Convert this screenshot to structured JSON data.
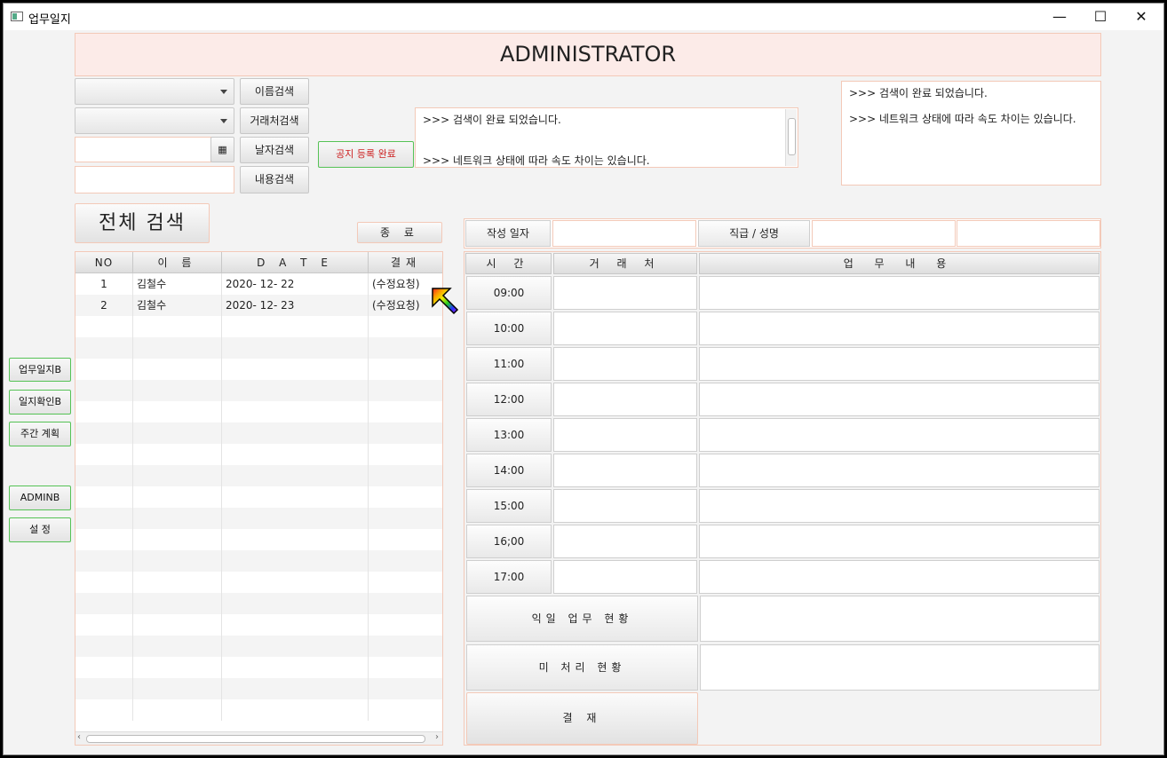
{
  "window": {
    "title": "업무일지"
  },
  "header": {
    "title": "ADMINISTRATOR"
  },
  "search": {
    "name_search": "이름검색",
    "client_search": "거래처검색",
    "date_search": "날자검색",
    "content_search": "내용검색",
    "notice_button": "공지 등록 완료",
    "full_search": "전체 검색",
    "exit_button": "종 료"
  },
  "messages": {
    "center_line1": ">>> 검색이 완료 되었습니다.",
    "center_line2": ">>> 네트워크 상태에 따라 속도 차이는 있습니다.",
    "right_line1": ">>> 검색이 완료 되었습니다.",
    "right_line2": ">>> 네트워크 상태에 따라 속도 차이는 있습니다."
  },
  "left_nav": {
    "items": [
      "업무일지B",
      "일지확인B",
      "주간 계획",
      "ADMINB",
      "설  정"
    ]
  },
  "list_table": {
    "columns": [
      "NO",
      "이 름",
      "D A T E",
      "결재"
    ],
    "rows": [
      {
        "no": "1",
        "name": "김철수",
        "date": "2020- 12- 22",
        "status": "(수정요청)"
      },
      {
        "no": "2",
        "name": "김철수",
        "date": "2020- 12- 23",
        "status": "(수정요청)"
      }
    ]
  },
  "detail": {
    "write_date_label": "작성 일자",
    "position_label": "직급 / 성명",
    "time_header": "시 간",
    "client_header": "거 래 처",
    "content_header": "업  무  내  용",
    "times": [
      "09:00",
      "10:00",
      "11:00",
      "12:00",
      "13:00",
      "14:00",
      "15:00",
      "16;00",
      "17:00"
    ],
    "next_day_label": "익일  업무  현황",
    "pending_label": "미  처리    현황",
    "approve_button": "결 재"
  }
}
